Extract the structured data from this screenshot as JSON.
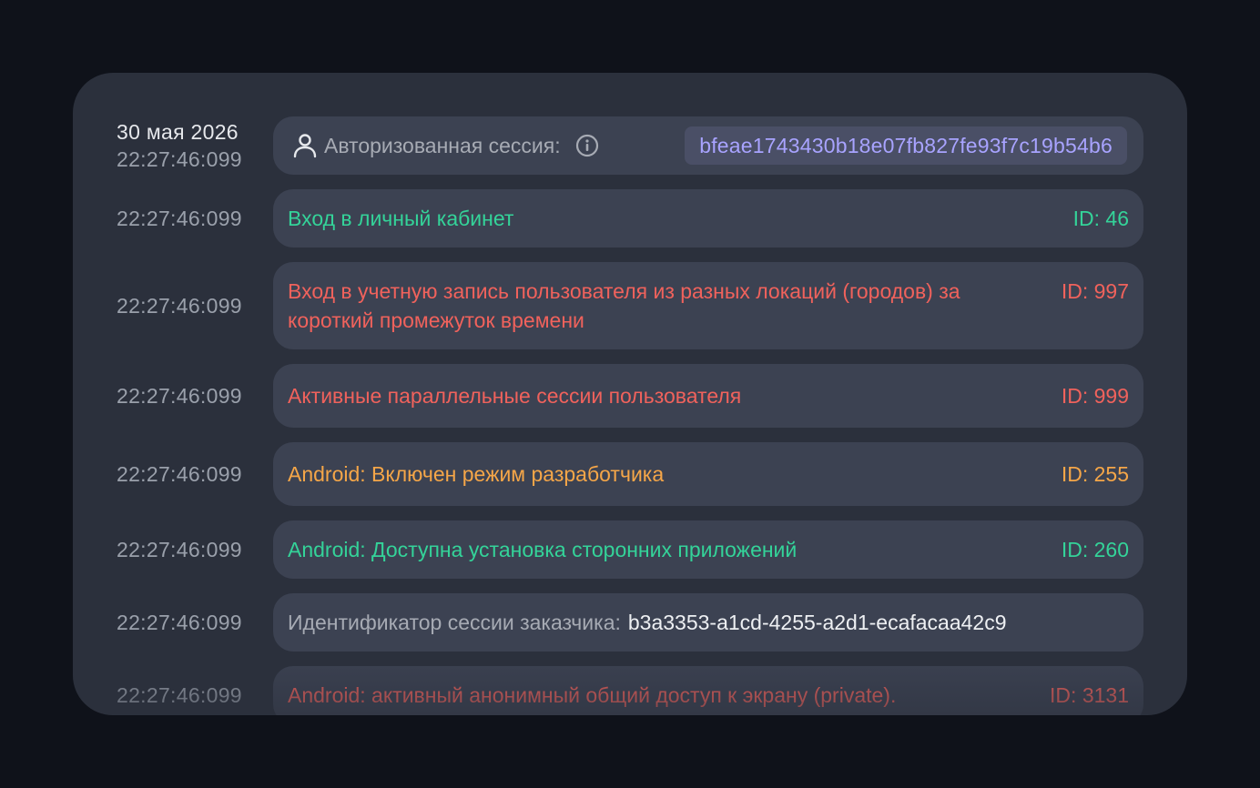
{
  "session": {
    "date": "30 мая 2026",
    "time": "22:27:46:099",
    "label": "Авторизованная сессия:",
    "hash": "bfeae1743430b18e07fb827fe93f7c19b54b6"
  },
  "events": [
    {
      "time": "22:27:46:099",
      "message": "Вход в личный кабинет",
      "id": "ID: 46",
      "color": "#34d399"
    },
    {
      "time": "22:27:46:099",
      "message": "Вход в учетную запись пользователя из разных локаций (городов) за короткий промежуток времени",
      "id": "ID: 997",
      "color": "#f0625c"
    },
    {
      "time": "22:27:46:099",
      "message": "Активные параллельные сессии пользователя",
      "id": "ID: 999",
      "color": "#f0625c"
    },
    {
      "time": "22:27:46:099",
      "message": "Android: Включен режим разработчика",
      "id": "ID: 255",
      "color": "#f5a648"
    },
    {
      "time": "22:27:46:099",
      "message": "Android: Доступна установка сторонних приложений",
      "id": "ID: 260",
      "color": "#34d399"
    }
  ],
  "customer_session": {
    "time": "22:27:46:099",
    "label": "Идентификатор сессии заказчика:",
    "value": "b3a3353-a1cd-4255-a2d1-ecafacaa42c9"
  },
  "last_event": {
    "time": "22:27:46:099",
    "message": "Android: активный анонимный общий доступ к экрану (private).",
    "id": "ID: 3131",
    "color": "#f0625c"
  },
  "icons": {
    "user": "user-icon",
    "info": "info-icon"
  }
}
